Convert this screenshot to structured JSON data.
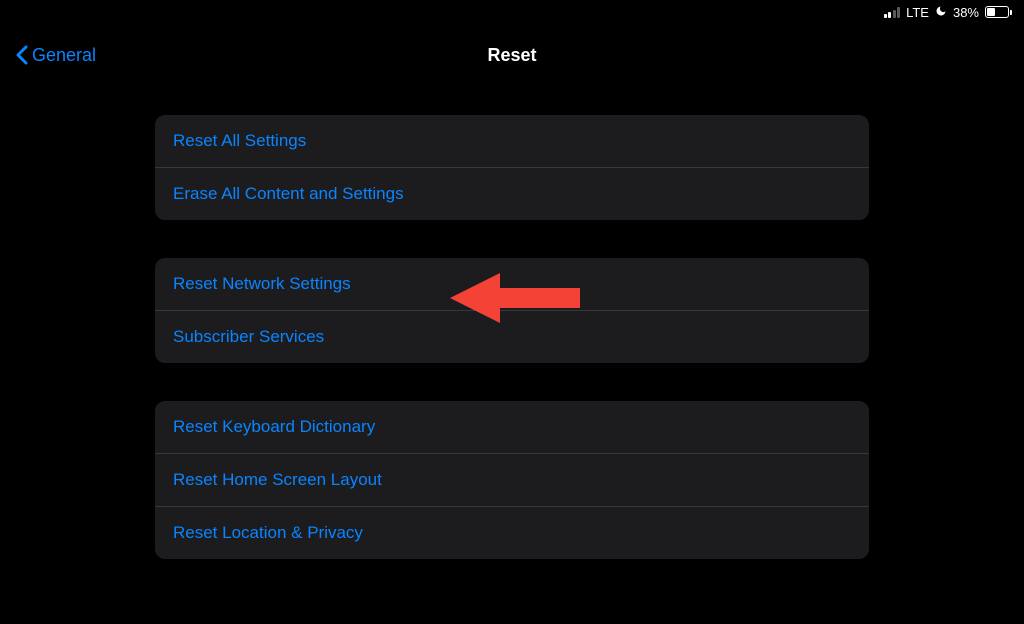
{
  "status_bar": {
    "carrier": "LTE",
    "battery_percent": "38%"
  },
  "nav": {
    "back_label": "General",
    "title": "Reset"
  },
  "groups": [
    {
      "rows": [
        {
          "label": "Reset All Settings",
          "name": "reset-all-settings"
        },
        {
          "label": "Erase All Content and Settings",
          "name": "erase-all-content"
        }
      ]
    },
    {
      "rows": [
        {
          "label": "Reset Network Settings",
          "name": "reset-network-settings"
        },
        {
          "label": "Subscriber Services",
          "name": "subscriber-services"
        }
      ]
    },
    {
      "rows": [
        {
          "label": "Reset Keyboard Dictionary",
          "name": "reset-keyboard-dictionary"
        },
        {
          "label": "Reset Home Screen Layout",
          "name": "reset-home-screen-layout"
        },
        {
          "label": "Reset Location & Privacy",
          "name": "reset-location-privacy"
        }
      ]
    }
  ],
  "annotation": {
    "color": "#f44336"
  }
}
